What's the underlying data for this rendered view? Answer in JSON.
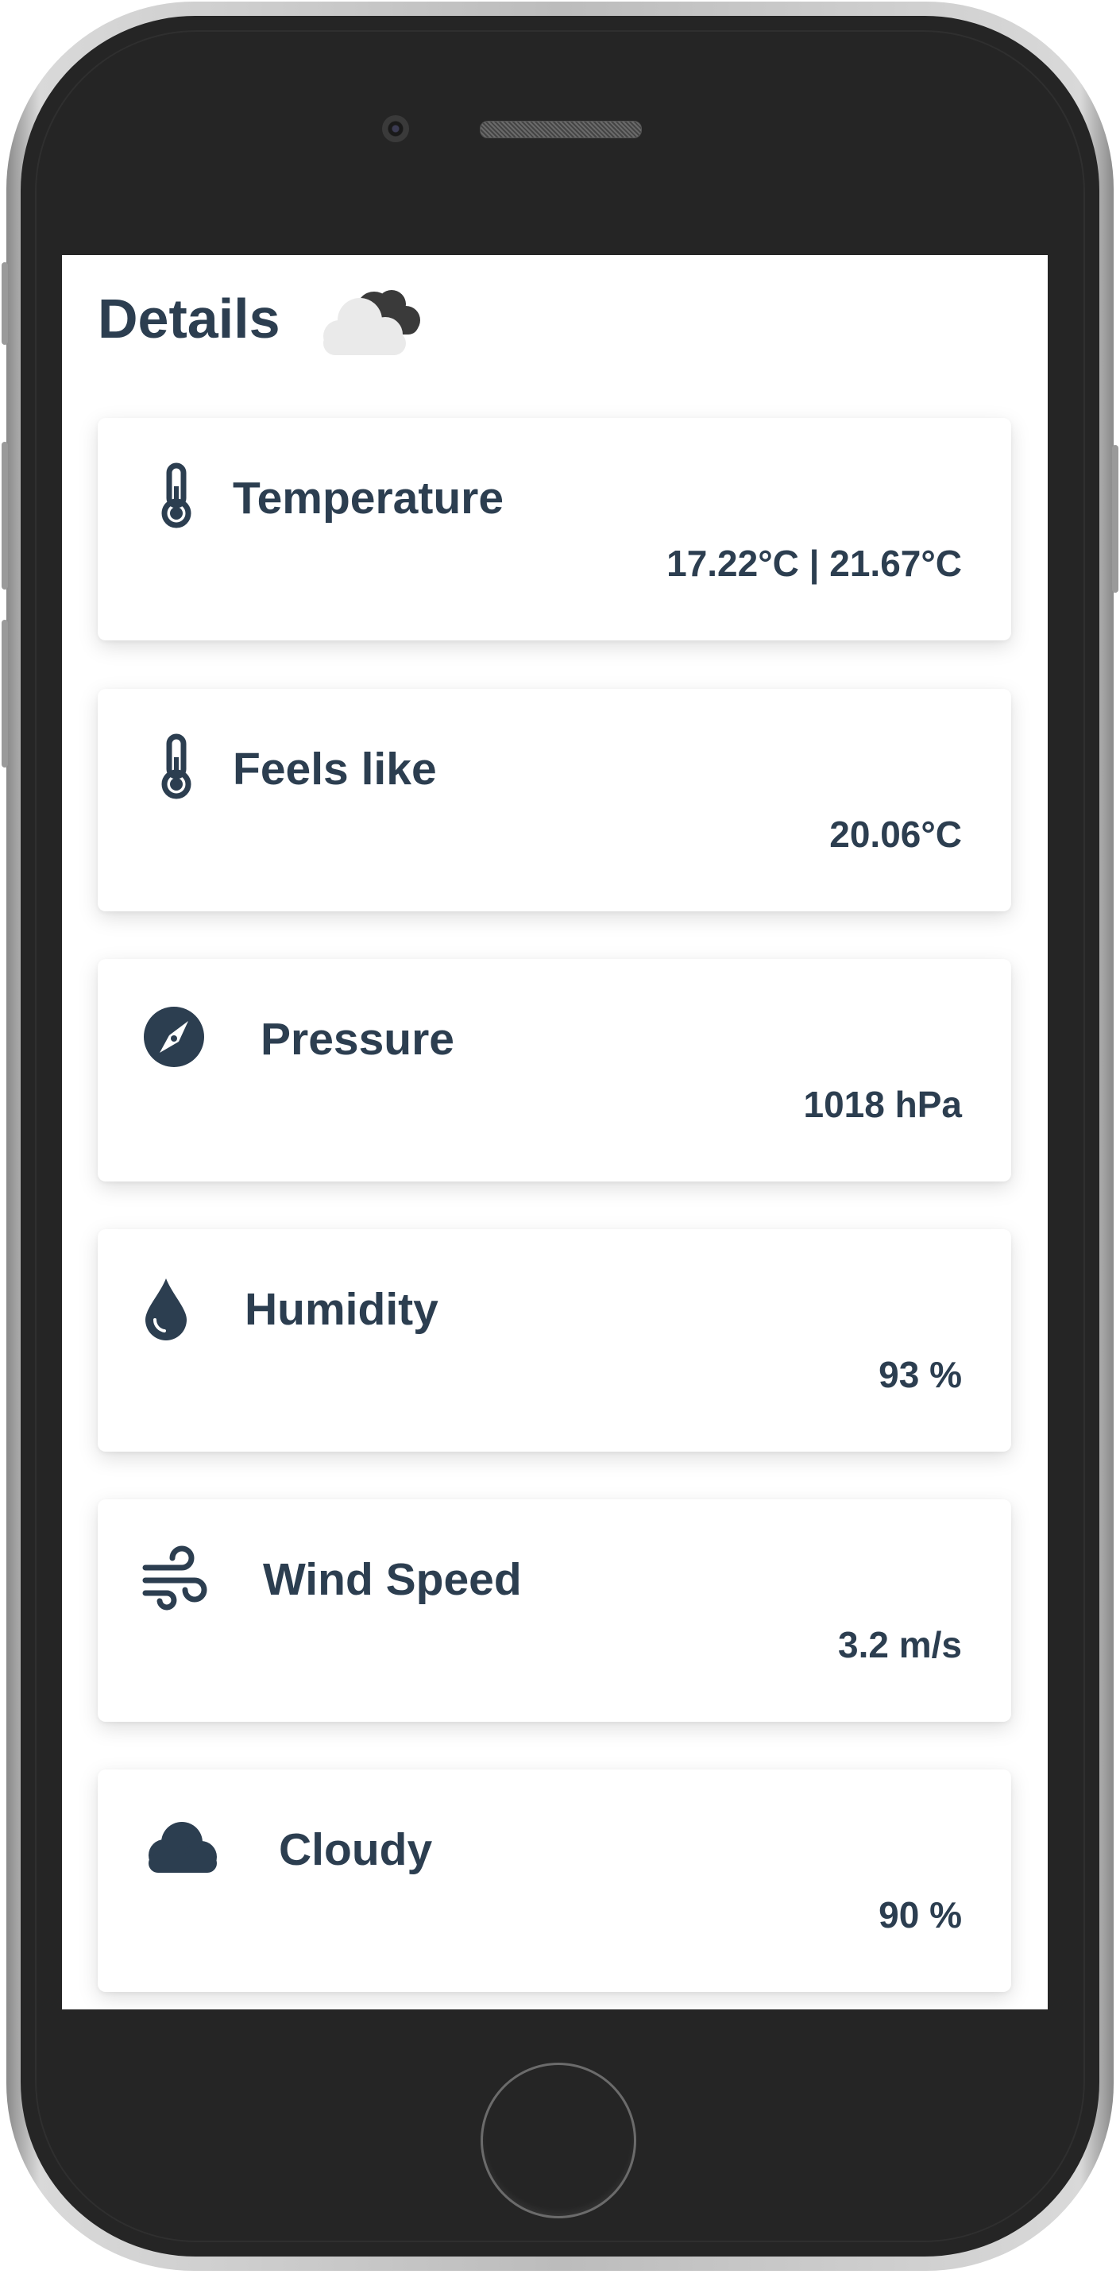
{
  "header": {
    "title": "Details",
    "icon": "cloudy-weather-icon"
  },
  "colors": {
    "text": "#2c3e50",
    "card_bg": "#ffffff",
    "frame": "#252525"
  },
  "details": [
    {
      "label": "Temperature",
      "value": "17.22°C | 21.67°C",
      "icon": "thermometer-icon"
    },
    {
      "label": "Feels like",
      "value": "20.06°C",
      "icon": "thermometer-icon"
    },
    {
      "label": "Pressure",
      "value": "1018 hPa",
      "icon": "compass-icon"
    },
    {
      "label": "Humidity",
      "value": "93 %",
      "icon": "droplet-icon"
    },
    {
      "label": "Wind Speed",
      "value": "3.2 m/s",
      "icon": "wind-icon"
    },
    {
      "label": "Cloudy",
      "value": "90 %",
      "icon": "cloud-icon"
    }
  ]
}
